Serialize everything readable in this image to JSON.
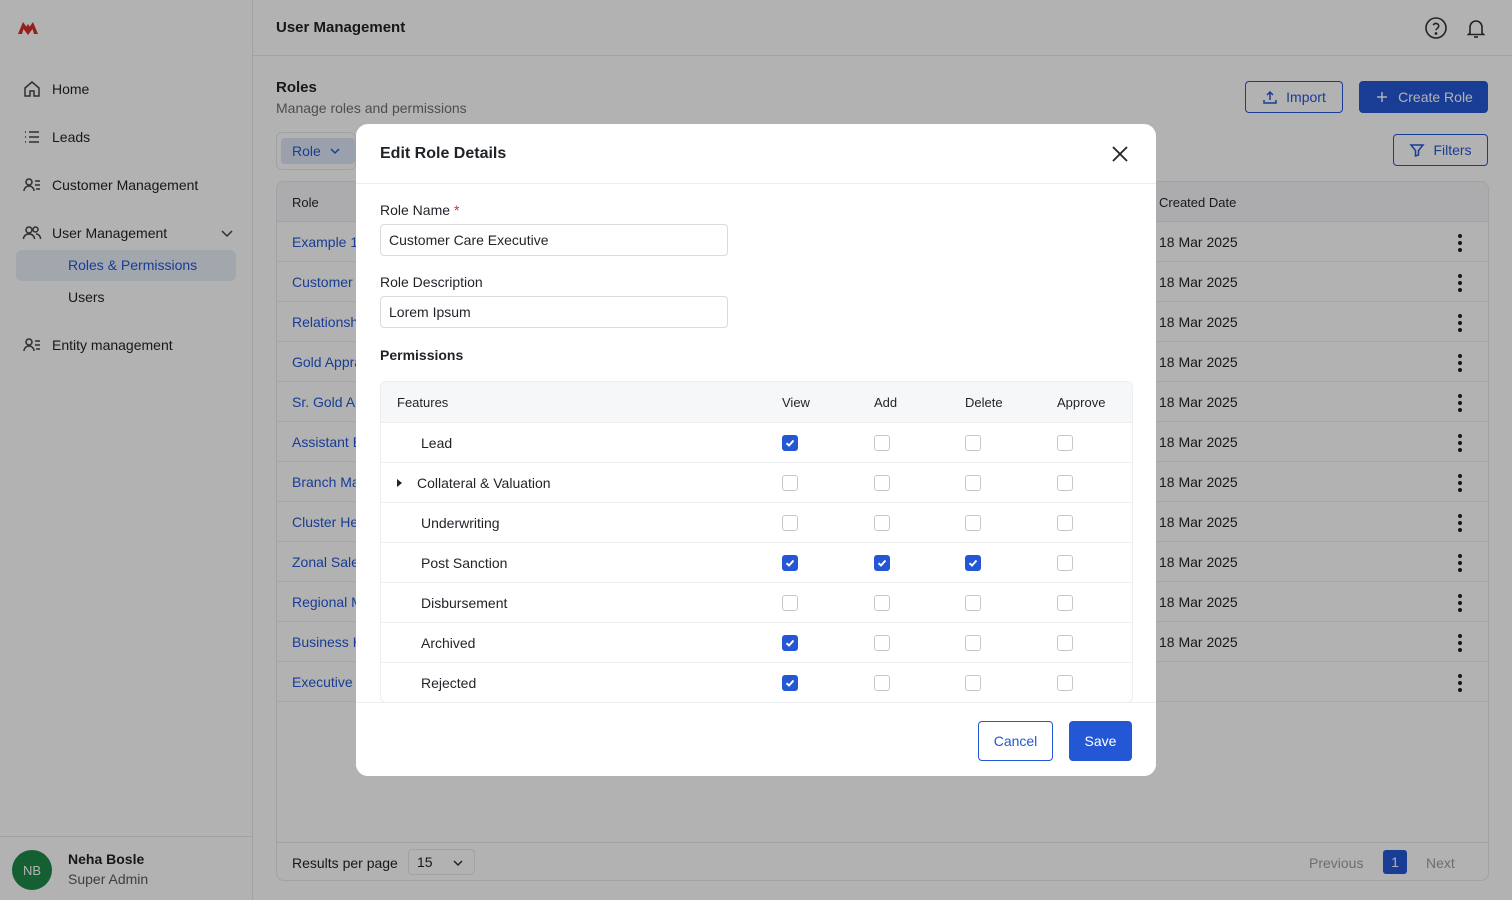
{
  "app": {
    "brand_color": "#d62d2d",
    "accent": "#2457d6"
  },
  "sidebar": {
    "items": [
      {
        "label": "Home",
        "icon": "home-icon"
      },
      {
        "label": "Leads",
        "icon": "list-icon"
      },
      {
        "label": "Customer Management",
        "icon": "contacts-icon"
      },
      {
        "label": "User Management",
        "icon": "users-icon",
        "expanded": true
      },
      {
        "label": "Entity management",
        "icon": "contacts-icon"
      }
    ],
    "subitems": [
      {
        "label": "Roles & Permissions",
        "active": true
      },
      {
        "label": "Users",
        "active": false
      }
    ],
    "user": {
      "initials": "NB",
      "name": "Neha Bosle",
      "role": "Super Admin"
    }
  },
  "header": {
    "title": "User Management"
  },
  "page": {
    "title": "Roles",
    "subtitle": "Manage roles and permissions",
    "import_label": "Import",
    "create_label": "Create Role",
    "filter_chip": "Role",
    "filters_label": "Filters"
  },
  "table": {
    "columns": [
      "Role",
      "Created Date"
    ],
    "rows": [
      {
        "role": "Example 1",
        "date": "18 Mar 2025"
      },
      {
        "role": "Customer",
        "date": "18 Mar 2025"
      },
      {
        "role": "Relationsh",
        "date": "18 Mar 2025"
      },
      {
        "role": "Gold Appra",
        "date": "18 Mar 2025"
      },
      {
        "role": "Sr. Gold Ap",
        "date": "18 Mar 2025"
      },
      {
        "role": "Assistant B",
        "date": "18 Mar 2025"
      },
      {
        "role": "Branch Ma",
        "date": "18 Mar 2025"
      },
      {
        "role": "Cluster He",
        "date": "18 Mar 2025"
      },
      {
        "role": "Zonal Sale",
        "date": "18 Mar 2025"
      },
      {
        "role": "Regional M",
        "date": "18 Mar 2025"
      },
      {
        "role": "Business H",
        "date": "18 Mar 2025"
      },
      {
        "role": "Executive",
        "date": ""
      }
    ],
    "pagination": {
      "rpp_label": "Results per page",
      "rpp_value": "15",
      "prev": "Previous",
      "page": "1",
      "next": "Next"
    }
  },
  "modal": {
    "title": "Edit Role Details",
    "role_name_label": "Role Name",
    "required_mark": "*",
    "role_name_value": "Customer Care Executive",
    "role_desc_label": "Role Description",
    "role_desc_value": "Lorem Ipsum",
    "permissions_title": "Permissions",
    "perm_columns": [
      "Features",
      "View",
      "Add",
      "Delete",
      "Approve"
    ],
    "perm_rows": [
      {
        "feature": "Lead",
        "expandable": false,
        "view": true,
        "add": false,
        "delete": false,
        "approve": false
      },
      {
        "feature": "Collateral & Valuation",
        "expandable": true,
        "view": false,
        "add": false,
        "delete": false,
        "approve": false
      },
      {
        "feature": "Underwriting",
        "expandable": false,
        "view": false,
        "add": false,
        "delete": false,
        "approve": false
      },
      {
        "feature": "Post Sanction",
        "expandable": false,
        "view": true,
        "add": true,
        "delete": true,
        "approve": false
      },
      {
        "feature": "Disbursement",
        "expandable": false,
        "view": false,
        "add": false,
        "delete": false,
        "approve": false
      },
      {
        "feature": "Archived",
        "expandable": false,
        "view": true,
        "add": false,
        "delete": false,
        "approve": false
      },
      {
        "feature": "Rejected",
        "expandable": false,
        "view": true,
        "add": false,
        "delete": false,
        "approve": false
      }
    ],
    "cancel_label": "Cancel",
    "save_label": "Save"
  }
}
